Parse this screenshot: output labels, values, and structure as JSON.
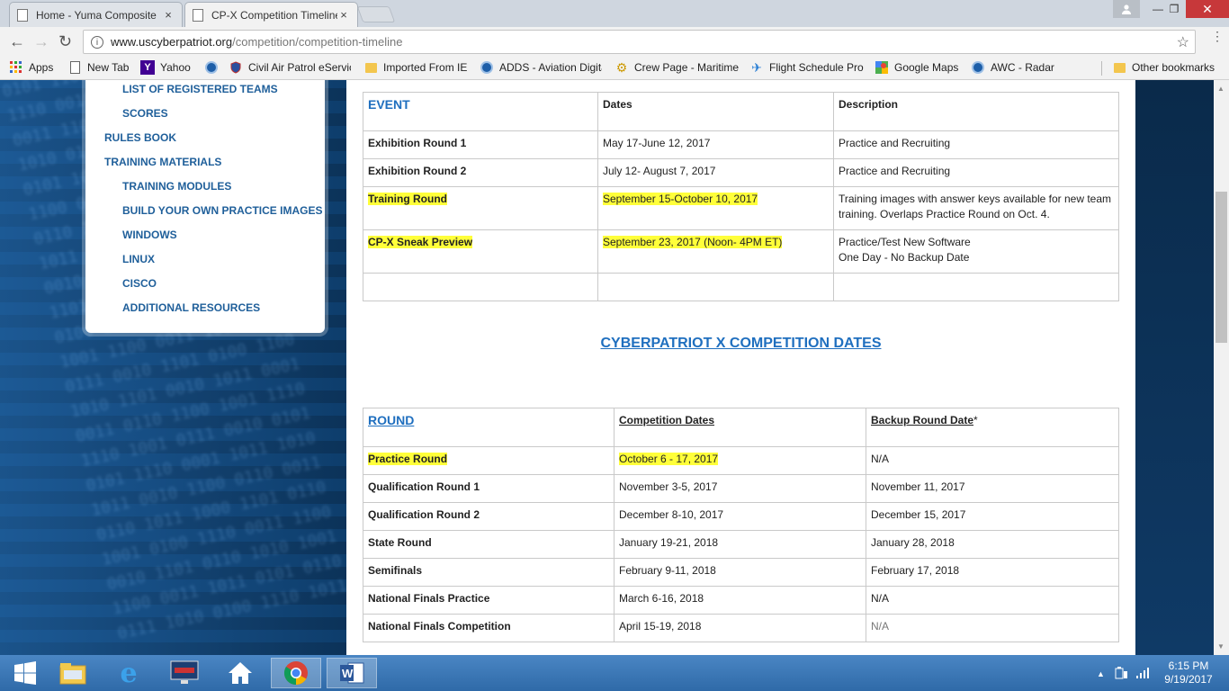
{
  "tabs": [
    {
      "title": "Home - Yuma Composite",
      "close": "×"
    },
    {
      "title": "CP-X Competition Timeline",
      "close": "×"
    }
  ],
  "window_controls": {
    "minimize": "—",
    "restore": "❐",
    "close": "✕"
  },
  "address": {
    "host": "www.uscyberpatriot.org",
    "path": "/competition/competition-timeline"
  },
  "bookmarks": [
    "Apps",
    "New Tab",
    "Yahoo",
    "Civil Air Patrol eServices",
    "Imported From IE",
    "ADDS - Aviation Digital",
    "Crew Page - Maritime",
    "Flight Schedule Pro",
    "Google Maps",
    "AWC - Radar",
    "Other bookmarks"
  ],
  "sidebar": {
    "items": [
      {
        "label": "LIST OF REGISTERED TEAMS"
      },
      {
        "label": "SCORES"
      },
      {
        "label": "RULES BOOK"
      },
      {
        "label": "TRAINING MATERIALS"
      },
      {
        "label": "TRAINING MODULES"
      },
      {
        "label": "BUILD YOUR OWN PRACTICE IMAGES"
      },
      {
        "label": "WINDOWS"
      },
      {
        "label": "LINUX"
      },
      {
        "label": "CISCO"
      },
      {
        "label": "ADDITIONAL RESOURCES"
      }
    ]
  },
  "events_table": {
    "headers": [
      "EVENT",
      "Dates",
      "Description"
    ],
    "rows": [
      {
        "event": "Exhibition Round 1",
        "dates": "May 17-June 12, 2017",
        "desc1": "Practice and Recruiting",
        "desc2": ""
      },
      {
        "event": "Exhibition Round 2",
        "dates": "July 12- August 7,  2017",
        "desc1": "Practice and Recruiting",
        "desc2": ""
      },
      {
        "event": "Training Round",
        "dates": "September 15-October 10, 2017",
        "desc1": "Training images with answer keys available for new team",
        "desc2": "training. Overlaps Practice Round on Oct. 4."
      },
      {
        "event": "CP-X Sneak Preview",
        "dates": "September 23, 2017 (Noon- 4PM ET)",
        "desc1": "Practice/Test New Software",
        "desc2": "One Day - No Backup Date"
      }
    ]
  },
  "section_title": "CYBERPATRIOT X COMPETITION DATES ",
  "rounds_table": {
    "headers": [
      "ROUND",
      "Competition Dates",
      "Backup Round Date",
      "*"
    ],
    "rows": [
      {
        "round": "Practice Round",
        "dates": "October 6 - 17, 2017",
        "backup": "N/A"
      },
      {
        "round": "Qualification Round 1",
        "dates": "November 3-5, 2017",
        "backup": "November 11, 2017"
      },
      {
        "round": "Qualification Round 2",
        "dates": "December 8-10, 2017",
        "backup": "December 15, 2017"
      },
      {
        "round": "State Round",
        "dates": "January 19-21, 2018",
        "backup": "January 28, 2018"
      },
      {
        "round": "Semifinals",
        "dates": "February 9-11, 2018",
        "backup": "February 17, 2018"
      },
      {
        "round": "National Finals Practice",
        "dates": "March 6-16, 2018",
        "backup": "N/A"
      },
      {
        "round": "National Finals Competition",
        "dates": "April 15-19, 2018",
        "backup": "N/A"
      }
    ]
  },
  "taskbar": {
    "time": "6:15 PM",
    "date": "9/19/2017"
  },
  "colors": {
    "link_blue": "#1f6fbf",
    "highlight": "#ffff3a",
    "taskbar": "#3f7ab8",
    "close_red": "#c7383a"
  }
}
